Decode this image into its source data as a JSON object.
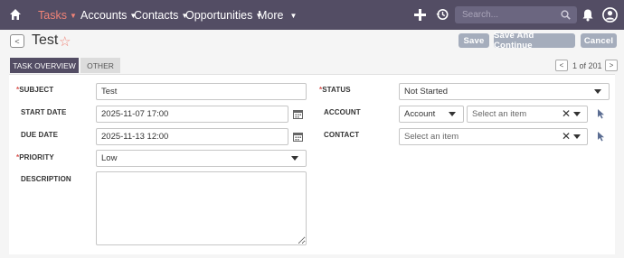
{
  "nav": {
    "tasks": "Tasks",
    "accounts": "Accounts",
    "contacts": "Contacts",
    "opportunities": "Opportunities",
    "more": "More"
  },
  "search": {
    "placeholder": "Search..."
  },
  "record": {
    "title": "Test"
  },
  "actions": {
    "save": "Save",
    "save_continue": "Save And Continue",
    "cancel": "Cancel"
  },
  "tabs": {
    "overview": "TASK OVERVIEW",
    "other": "OTHER"
  },
  "pager": {
    "text": "1 of 201"
  },
  "form": {
    "subject_label": "SUBJECT",
    "subject_value": "Test",
    "start_label": "START DATE",
    "start_value": "2025-11-07 17:00",
    "due_label": "DUE DATE",
    "due_value": "2025-11-13 12:00",
    "priority_label": "PRIORITY",
    "priority_value": "Low",
    "description_label": "DESCRIPTION",
    "status_label": "STATUS",
    "status_value": "Not Started",
    "account_label": "ACCOUNT",
    "account_type": "Account",
    "account_placeholder": "Select an item",
    "contact_label": "CONTACT",
    "contact_placeholder": "Select an item"
  },
  "colors": {
    "topbar": "#534d64",
    "accent": "#f08377",
    "button": "#a5adbc",
    "required": "#d9534f"
  }
}
